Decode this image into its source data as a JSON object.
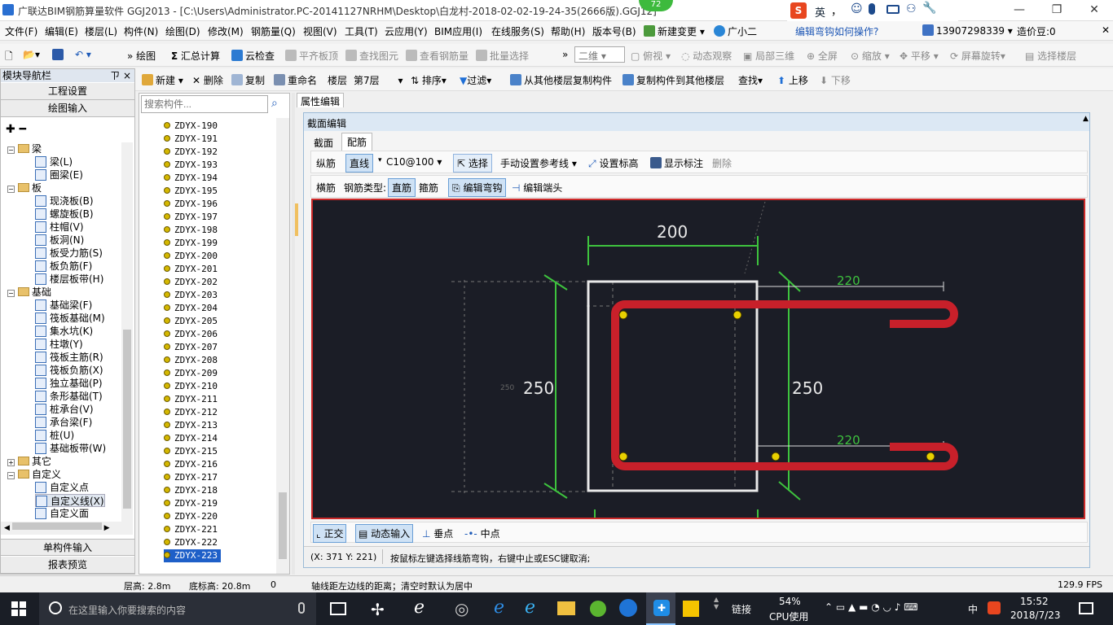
{
  "app": {
    "title": "广联达BIM钢筋算量软件 GGJ2013 - [C:\\Users\\Administrator.PC-20141127NRHM\\Desktop\\白龙村-2018-02-02-19-24-35(2666版).GGJ12]",
    "badge": "72"
  },
  "window_controls": {
    "minimize": "—",
    "maximize": "❐",
    "close": "✕"
  },
  "menu": [
    "文件(F)",
    "编辑(E)",
    "楼层(L)",
    "构件(N)",
    "绘图(D)",
    "修改(M)",
    "钢筋量(Q)",
    "视图(V)",
    "工具(T)",
    "云应用(Y)",
    "BIM应用(I)",
    "在线服务(S)",
    "帮助(H)",
    "版本号(B)",
    "新建变更",
    "广小二"
  ],
  "menu_right": {
    "help_link": "编辑弯钩如何操作?",
    "phone": "13907298339",
    "price": "造价豆:0"
  },
  "ime": [
    "英",
    "，"
  ],
  "toolbar1": [
    {
      "label": "绘图"
    },
    {
      "label": "汇总计算"
    },
    {
      "label": "云检查"
    },
    {
      "label": "平齐板顶",
      "disabled": true
    },
    {
      "label": "查找图元",
      "disabled": true
    },
    {
      "label": "查看钢筋量",
      "disabled": true
    },
    {
      "label": "批量选择",
      "disabled": true
    }
  ],
  "view_mode": "二维",
  "toolbar1_right": [
    {
      "label": "俯视",
      "disabled": true
    },
    {
      "label": "动态观察",
      "disabled": true
    },
    {
      "label": "局部三维",
      "disabled": true
    },
    {
      "label": "全屏",
      "disabled": true
    },
    {
      "label": "缩放",
      "disabled": true
    },
    {
      "label": "平移",
      "disabled": true
    },
    {
      "label": "屏幕旋转",
      "disabled": true
    },
    {
      "label": "选择楼层",
      "disabled": true
    }
  ],
  "toolbar2": [
    "新建",
    "删除",
    "复制",
    "重命名",
    "楼层",
    "第7层",
    "排序",
    "过滤",
    "从其他楼层复制构件",
    "复制构件到其他楼层",
    "查找",
    "上移",
    "下移"
  ],
  "nav": {
    "header": "模块导航栏",
    "pin": "ㄗ ×",
    "btn_top1": "工程设置",
    "btn_top2": "绘图输入",
    "btn_bottom1": "单构件输入",
    "btn_bottom2": "报表预览"
  },
  "tree": [
    {
      "label": "梁",
      "level": 0,
      "folder": true
    },
    {
      "label": "梁(L)",
      "level": 1
    },
    {
      "label": "圈梁(E)",
      "level": 1
    },
    {
      "label": "板",
      "level": 0,
      "folder": true
    },
    {
      "label": "现浇板(B)",
      "level": 1
    },
    {
      "label": "螺旋板(B)",
      "level": 1
    },
    {
      "label": "柱帽(V)",
      "level": 1
    },
    {
      "label": "板洞(N)",
      "level": 1
    },
    {
      "label": "板受力筋(S)",
      "level": 1
    },
    {
      "label": "板负筋(F)",
      "level": 1
    },
    {
      "label": "楼层板带(H)",
      "level": 1
    },
    {
      "label": "基础",
      "level": 0,
      "folder": true
    },
    {
      "label": "基础梁(F)",
      "level": 1
    },
    {
      "label": "筏板基础(M)",
      "level": 1
    },
    {
      "label": "集水坑(K)",
      "level": 1
    },
    {
      "label": "柱墩(Y)",
      "level": 1
    },
    {
      "label": "筏板主筋(R)",
      "level": 1
    },
    {
      "label": "筏板负筋(X)",
      "level": 1
    },
    {
      "label": "独立基础(P)",
      "level": 1
    },
    {
      "label": "条形基础(T)",
      "level": 1
    },
    {
      "label": "桩承台(V)",
      "level": 1
    },
    {
      "label": "承台梁(F)",
      "level": 1
    },
    {
      "label": "桩(U)",
      "level": 1
    },
    {
      "label": "基础板带(W)",
      "level": 1
    },
    {
      "label": "其它",
      "level": 0,
      "folder": true,
      "collapsed": true
    },
    {
      "label": "自定义",
      "level": 0,
      "folder": true
    },
    {
      "label": "自定义点",
      "level": 1
    },
    {
      "label": "自定义线(X)",
      "level": 1,
      "selected": true
    },
    {
      "label": "自定义面",
      "level": 1
    }
  ],
  "search_placeholder": "搜索构件...",
  "components": [
    "ZDYX-190",
    "ZDYX-191",
    "ZDYX-192",
    "ZDYX-193",
    "ZDYX-194",
    "ZDYX-195",
    "ZDYX-196",
    "ZDYX-197",
    "ZDYX-198",
    "ZDYX-199",
    "ZDYX-200",
    "ZDYX-201",
    "ZDYX-202",
    "ZDYX-203",
    "ZDYX-204",
    "ZDYX-205",
    "ZDYX-206",
    "ZDYX-207",
    "ZDYX-208",
    "ZDYX-209",
    "ZDYX-210",
    "ZDYX-211",
    "ZDYX-212",
    "ZDYX-213",
    "ZDYX-214",
    "ZDYX-215",
    "ZDYX-216",
    "ZDYX-217",
    "ZDYX-218",
    "ZDYX-219",
    "ZDYX-220",
    "ZDYX-221",
    "ZDYX-222",
    "ZDYX-223"
  ],
  "selected_component": "ZDYX-223",
  "prop_tab": "属性编辑",
  "editor": {
    "title": "截面编辑",
    "tabs": [
      "截面",
      "配筋"
    ],
    "active_tab": "配筋",
    "row1": {
      "longit": "纵筋",
      "line": "直线",
      "spec": "C10@100",
      "select": "选择",
      "ref": "手动设置参考线",
      "elev": "设置标高",
      "label": "显示标注",
      "del": "删除"
    },
    "row2": {
      "trans": "横筋",
      "type_label": "钢筋类型:",
      "straight": "直筋",
      "stirrup": "箍筋",
      "edit_hook": "编辑弯钩",
      "edit_end": "编辑端头"
    },
    "bottom": {
      "ortho": "正交",
      "dynamic": "动态输入",
      "perp": "垂点",
      "mid": "中点"
    },
    "status_coord": "(X: 371 Y: 221)",
    "status_msg": "按鼠标左键选择线筋弯钩，右键中止或ESC键取消;"
  },
  "dims": {
    "top": "200",
    "left": "250",
    "right": "250",
    "upper": "220",
    "lower": "220",
    "small": "250"
  },
  "statusbar": {
    "floor_h": "层高: 2.8m",
    "base_h": "底标高: 20.8m",
    "val": "0",
    "msg": "轴线距左边线的距离；清空时默认为居中",
    "fps": "129.9 FPS"
  },
  "taskbar": {
    "search": "在这里输入你要搜索的内容",
    "link": "链接",
    "cpu": "54%",
    "cpu_label": "CPU使用",
    "lang": "中",
    "time": "15:52",
    "date": "2018/7/23"
  },
  "colors": {
    "rebar": "#c8202a",
    "dim": "#3ec33e",
    "canvas_bg": "#1b1d26",
    "frame": "#cc2a2a",
    "node": "#e8d000"
  }
}
